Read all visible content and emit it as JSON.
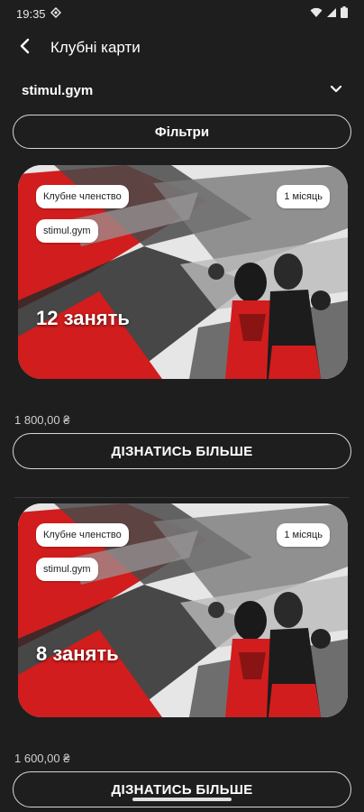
{
  "status_bar": {
    "time": "19:35"
  },
  "header": {
    "title": "Клубні карти"
  },
  "club_selector": {
    "value": "stimul.gym"
  },
  "filters": {
    "label": "Фільтри"
  },
  "cards": [
    {
      "membership_label": "Клубне членство",
      "club_label": "stimul.gym",
      "duration_label": "1 місяць",
      "sessions_label": "12 занять",
      "price": "1 800,00 ₴",
      "button_label": "ДІЗНАТИСЬ БІЛЬШЕ"
    },
    {
      "membership_label": "Клубне членство",
      "club_label": "stimul.gym",
      "duration_label": "1 місяць",
      "sessions_label": "8 занять",
      "price": "1 600,00 ₴",
      "button_label": "ДІЗНАТИСЬ БІЛЬШЕ"
    }
  ],
  "colors": {
    "background": "#1e1e1e",
    "accent_red": "#d11d1d",
    "outline": "#d6d6d6"
  }
}
